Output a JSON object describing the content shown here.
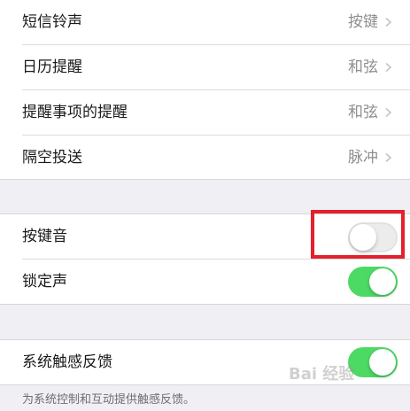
{
  "group1": {
    "rows": [
      {
        "label": "短信铃声",
        "value": "按键"
      },
      {
        "label": "日历提醒",
        "value": "和弦"
      },
      {
        "label": "提醒事项的提醒",
        "value": "和弦"
      },
      {
        "label": "隔空投送",
        "value": "脉冲"
      }
    ]
  },
  "group2": {
    "rows": [
      {
        "label": "按键音",
        "toggle": "off"
      },
      {
        "label": "锁定声",
        "toggle": "on"
      }
    ]
  },
  "group3": {
    "rows": [
      {
        "label": "系统触感反馈",
        "toggle": "on"
      }
    ],
    "footnote": "为系统控制和互动提供触感反馈。"
  },
  "watermark": "Bai 经验",
  "colors": {
    "background": "#efeff4",
    "toggle_on": "#4cd964",
    "highlight_border": "#e3202b",
    "value_text": "#8e8e93"
  },
  "icons": [
    "chevron-right-icon"
  ]
}
